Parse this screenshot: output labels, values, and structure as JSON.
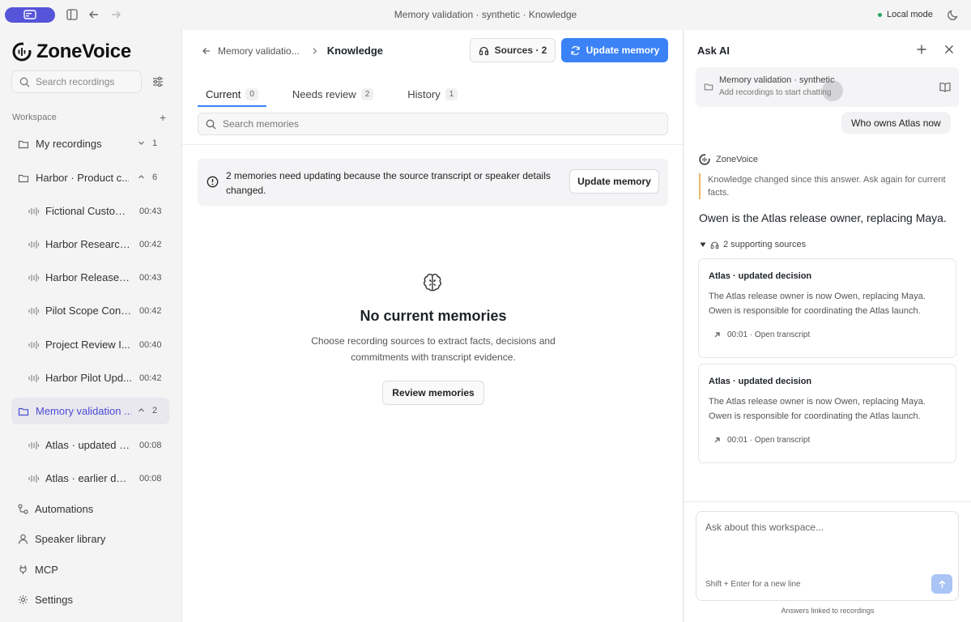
{
  "titlebar": {
    "title": "Memory validation · synthetic · Knowledge",
    "mode": "Local mode"
  },
  "sidebar": {
    "brand": "ZoneVoice",
    "search_placeholder": "Search recordings",
    "workspace_label": "Workspace",
    "folders": [
      {
        "label": "My recordings",
        "count": "1"
      },
      {
        "label": "Harbor · Product c...",
        "count": "6"
      },
      {
        "label": "Memory validation ...",
        "count": "2"
      }
    ],
    "harbor_recordings": [
      {
        "label": "Fictional Custom...",
        "time": "00:43"
      },
      {
        "label": "Harbor Research ...",
        "time": "00:42"
      },
      {
        "label": "Harbor Release P...",
        "time": "00:43"
      },
      {
        "label": "Pilot Scope Confi...",
        "time": "00:42"
      },
      {
        "label": "Project Review I...",
        "time": "00:40"
      },
      {
        "label": "Harbor Pilot Upd...",
        "time": "00:42"
      }
    ],
    "memory_recordings": [
      {
        "label": "Atlas · updated d...",
        "time": "00:08"
      },
      {
        "label": "Atlas · earlier dec...",
        "time": "00:08"
      }
    ],
    "bottom": [
      "Automations",
      "Speaker library",
      "MCP",
      "Settings"
    ]
  },
  "main": {
    "breadcrumb_parent": "Memory validatio...",
    "breadcrumb_current": "Knowledge",
    "sources_button": "Sources · 2",
    "update_button": "Update memory",
    "tabs": [
      {
        "label": "Current",
        "count": "0"
      },
      {
        "label": "Needs review",
        "count": "2"
      },
      {
        "label": "History",
        "count": "1"
      }
    ],
    "search_placeholder": "Search memories",
    "notice_text": "2 memories need updating because the source transcript or speaker details changed.",
    "notice_button": "Update memory",
    "empty_title": "No current memories",
    "empty_desc_line1": "Choose recording sources to extract facts, decisions and",
    "empty_desc_line2": "commitments with transcript evidence.",
    "review_button": "Review memories"
  },
  "ai": {
    "title": "Ask AI",
    "context_title": "Memory validation · synthetic",
    "context_sub": "Add recordings to start chatting",
    "user_question": "Who owns Atlas now",
    "bot_name": "ZoneVoice",
    "changed_note": "Knowledge changed since this answer. Ask again for current facts.",
    "answer": "Owen is the Atlas release owner, replacing Maya.",
    "sources_toggle": "2 supporting sources",
    "sources": [
      {
        "title": "Atlas · updated decision",
        "text": "The Atlas release owner is now Owen, replacing Maya. Owen is responsible for coordinating the Atlas launch.",
        "link": "00:01 · Open transcript"
      },
      {
        "title": "Atlas · updated decision",
        "text": "The Atlas release owner is now Owen, replacing Maya. Owen is responsible for coordinating the Atlas launch.",
        "link": "00:01 · Open transcript"
      }
    ],
    "input_placeholder": "Ask about this workspace...",
    "input_hint": "Shift + Enter for a new line",
    "footnote": "Answers linked to recordings"
  },
  "colors": {
    "accent": "#5654d8",
    "primary_button": "#3b82f6",
    "status_dot": "#2aa866",
    "warning_bar": "#e8b86b"
  }
}
